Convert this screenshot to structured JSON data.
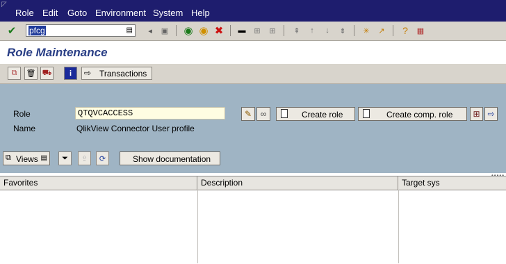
{
  "menu": {
    "items": [
      "Role",
      "Edit",
      "Goto",
      "Environment",
      "System",
      "Help"
    ]
  },
  "toolbar": {
    "command_field": "pfcg"
  },
  "page": {
    "title": "Role Maintenance"
  },
  "app_toolbar": {
    "transactions_label": "Transactions"
  },
  "form": {
    "role_label": "Role",
    "role_value": "QTQVCACCESS",
    "name_label": "Name",
    "name_value": "QlikView Connector User profile",
    "create_role_label": "Create role",
    "create_comp_role_label": "Create comp. role"
  },
  "subtools": {
    "views_label": "Views",
    "show_doc_label": "Show documentation"
  },
  "table": {
    "columns": [
      "Favorites",
      "Description",
      "Target sys"
    ]
  },
  "colors": {
    "menubar": "#1e1d6e",
    "blue_area": "#9fb4c4",
    "title": "#2a3f86"
  }
}
